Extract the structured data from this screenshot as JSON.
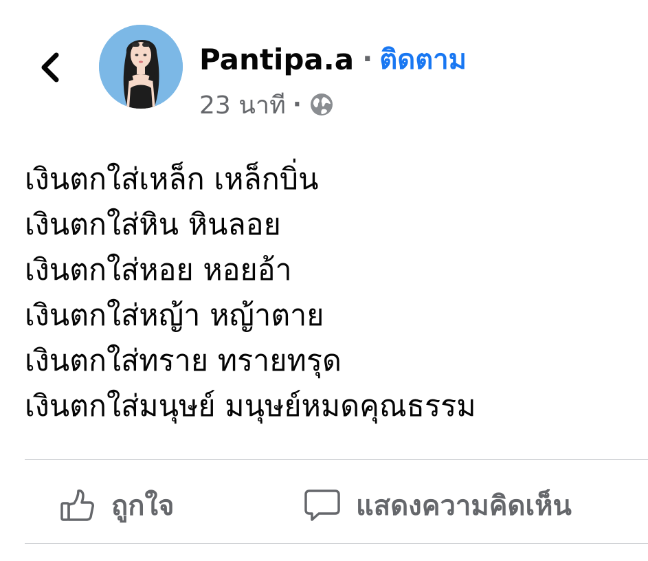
{
  "header": {
    "author": "Pantipa.a",
    "separator": "·",
    "follow_label": "ติดตาม",
    "timestamp": "23 นาที",
    "meta_separator": "·"
  },
  "icons": {
    "back": "chevron-left-icon",
    "privacy": "globe-icon",
    "like": "thumbs-up-icon",
    "comment": "speech-bubble-icon"
  },
  "post": {
    "lines": [
      "เงินตกใส่เหล็ก เหล็กบิ่น",
      "เงินตกใส่หิน หินลอย",
      "เงินตกใส่หอย หอยอ้า",
      "เงินตกใส่หญ้า หญ้าตาย",
      "เงินตกใส่ทราย ทรายทรุด",
      "เงินตกใส่มนุษย์ มนุษย์หมดคุณธรรม"
    ]
  },
  "actions": {
    "like_label": "ถูกใจ",
    "comment_label": "แสดงความคิดเห็น"
  },
  "colors": {
    "follow": "#1877f2",
    "secondary_text": "#65676b",
    "avatar_background": "#7cb8e6"
  }
}
